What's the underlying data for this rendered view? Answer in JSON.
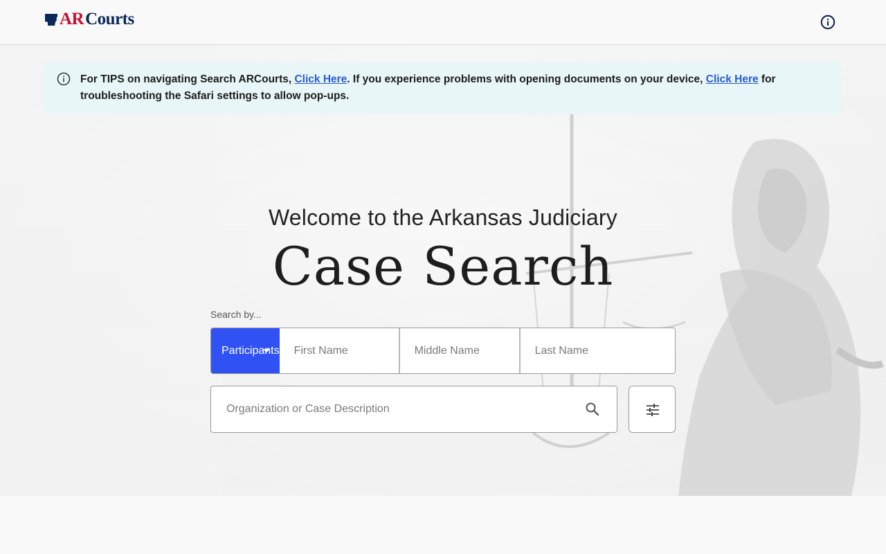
{
  "header": {
    "logo_ar": "AR",
    "logo_courts": "Courts",
    "info_icon": "info-circle-icon"
  },
  "banner": {
    "icon": "info-circle-icon",
    "text_before": "For TIPS on navigating Search ARCourts, ",
    "link1": "Click Here",
    "text_middle": ". If you experience problems with opening documents on your device, ",
    "link2": "Click Here",
    "text_after": " for troubleshooting the Safari settings to allow pop-ups."
  },
  "hero": {
    "welcome": "Welcome to the Arkansas Judiciary",
    "title": "Case Search"
  },
  "search": {
    "label": "Search by...",
    "type_selected": "Participants",
    "first_name_placeholder": "First Name",
    "middle_name_placeholder": "Middle Name",
    "last_name_placeholder": "Last Name",
    "description_placeholder": "Organization or Case Description",
    "search_icon": "search-icon",
    "filter_icon": "tune-filter-icon"
  },
  "colors": {
    "brand_red": "#c8102e",
    "brand_navy": "#0b2a5b",
    "accent_blue": "#3052f4",
    "banner_bg": "#e8f6f8",
    "link": "#2b5bd8"
  }
}
